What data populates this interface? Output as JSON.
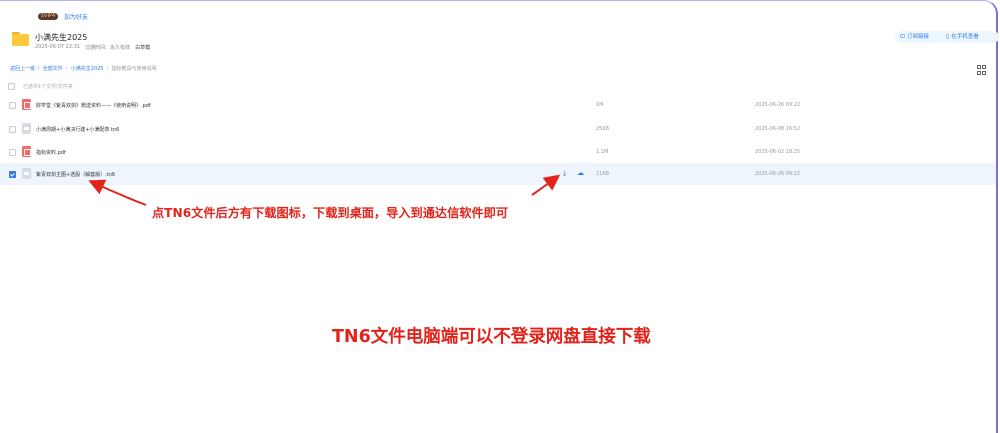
{
  "header": {
    "user_badge": "SVIP4",
    "add_friend": "加为好友"
  },
  "share": {
    "folder_title": "小满先生2025",
    "created": "2025-06-07 22:31",
    "expiry": "过期时间：永久有效",
    "owner": "白草模",
    "save_button": "订阅链接",
    "phone_button": "在手机查看"
  },
  "breadcrumb": {
    "back": "返回上一级",
    "all_files": "全部文件",
    "folder": "小满先生2025",
    "current": "指标教具与使用说明"
  },
  "list": {
    "select_all_label": "已选中1个文件/文件夹",
    "files": [
      {
        "name": "财学堂《紫青双剑》赠送资料——《使用说明》.pdf",
        "size": "1M",
        "date": "2025-06-26 09:22",
        "type": "pdf",
        "checked": false
      },
      {
        "name": "小满周期+小满决行建+小满配饰.tn6",
        "size": "25KB",
        "date": "2025-06-08 16:52",
        "type": "file",
        "checked": false
      },
      {
        "name": "指标资料.pdf",
        "size": "1.1M",
        "date": "2025-06-02 18:25",
        "type": "pdf",
        "checked": false
      },
      {
        "name": "紫青双剑主图+选股（解套版）.tn6",
        "size": "11KB",
        "date": "2025-06-26 09:22",
        "type": "file",
        "checked": true
      }
    ]
  },
  "annotations": {
    "arrow_tip": "点TN6文件后方有下载图标，下载到桌面，导入到通达信软件即可",
    "headline": "TN6文件电脑端可以不登录网盘直接下载",
    "color": "#e2231a"
  }
}
